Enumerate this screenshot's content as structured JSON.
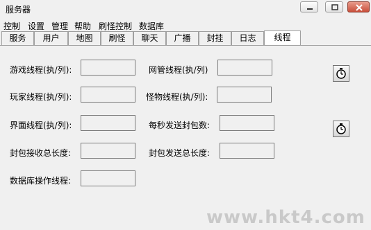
{
  "window": {
    "title": "服务器"
  },
  "menu": [
    "控制",
    "设置",
    "管理",
    "帮助",
    "刷怪控制",
    "数据库"
  ],
  "tabs": [
    "服务",
    "用户",
    "地图",
    "刷怪",
    "聊天",
    "广播",
    "封挂",
    "日志",
    "线程"
  ],
  "active_tab": "线程",
  "fields": {
    "game_threads": {
      "label": "游戏线程(执/列):",
      "value": ""
    },
    "netmgr_threads": {
      "label": "网管线程(执/列)",
      "value": ""
    },
    "player_threads": {
      "label": "玩家线程(执/列):",
      "value": ""
    },
    "monster_threads": {
      "label": "怪物线程(执/列):",
      "value": ""
    },
    "ui_threads": {
      "label": "界面线程(执/列):",
      "value": ""
    },
    "packets_per_sec": {
      "label": "每秒发送封包数:",
      "value": ""
    },
    "recv_total_len": {
      "label": "封包接收总长度:",
      "value": ""
    },
    "send_total_len": {
      "label": "封包发送总长度:",
      "value": ""
    },
    "db_threads": {
      "label": "数据库操作线程:",
      "value": ""
    }
  },
  "icons": {
    "timer": "stopwatch-icon"
  },
  "watermark": "www.hkt4.com"
}
